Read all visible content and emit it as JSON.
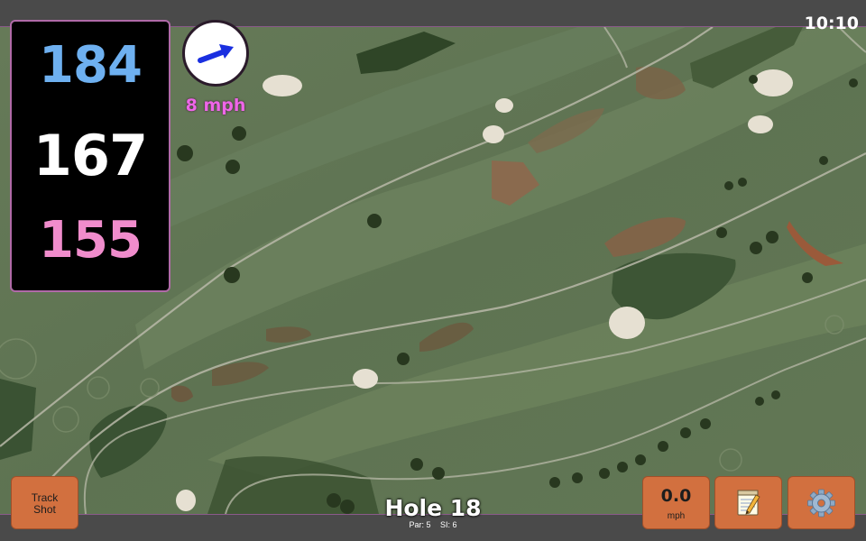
{
  "status_bar": {
    "time": "10:10"
  },
  "distances": {
    "back": "184",
    "middle": "167",
    "front": "155"
  },
  "wind": {
    "speed": "8 mph",
    "icon": "wind-direction-arrow-icon",
    "color": "#1a2fe0"
  },
  "hole": {
    "title": "Hole 18",
    "par": "Par: 5",
    "stroke_index": "SI: 6"
  },
  "buttons": {
    "track_shot": {
      "line1": "Track",
      "line2": "Shot"
    },
    "speed": {
      "value": "0.0",
      "unit": "mph"
    },
    "notes": {
      "icon": "notepad-pencil-icon"
    },
    "settings": {
      "icon": "gear-icon"
    }
  },
  "colors": {
    "accent_button": "#d2703f",
    "back_distance": "#6eb0f0",
    "front_distance": "#f08ccc",
    "wind_text": "#ee66e8",
    "panel_border": "#b06aa8"
  }
}
